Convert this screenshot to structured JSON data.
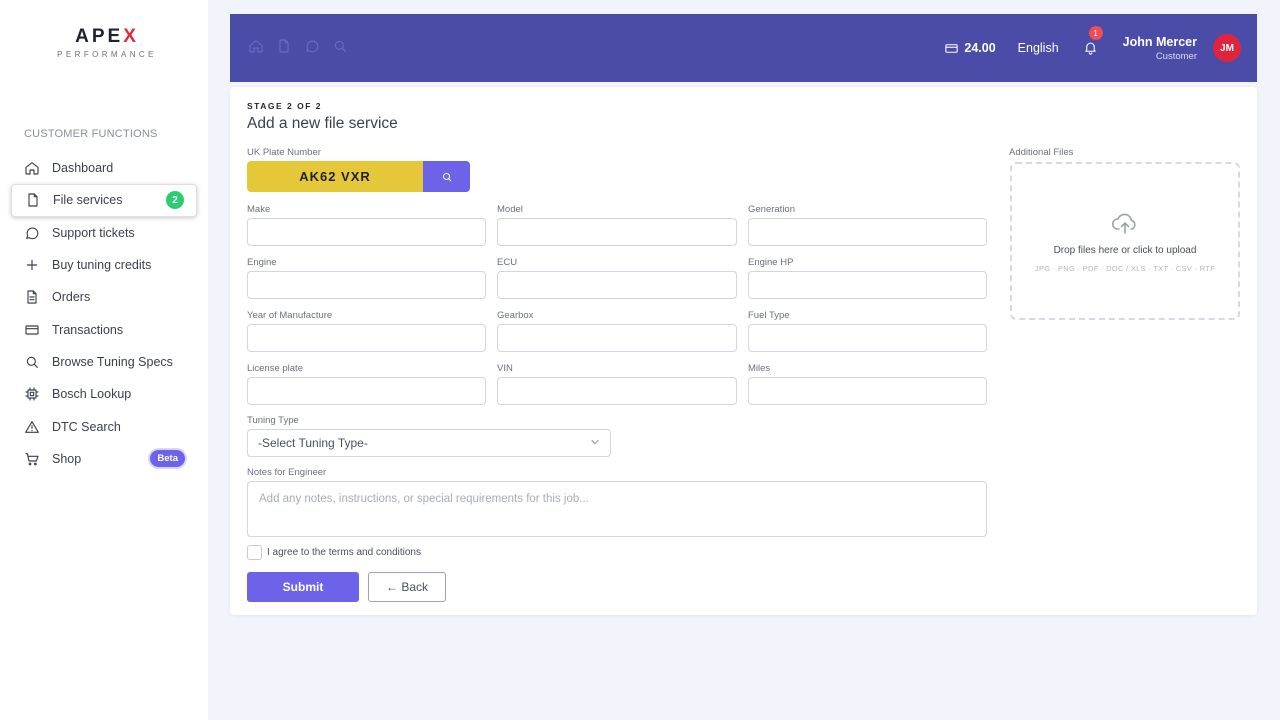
{
  "brand": {
    "name_prefix": "APE",
    "name_suffix": "X",
    "tagline": "PERFORMANCE"
  },
  "sidebar": {
    "section_title": "CUSTOMER FUNCTIONS",
    "items": [
      {
        "label": "Dashboard",
        "icon": "home-icon"
      },
      {
        "label": "File services",
        "icon": "file-icon",
        "badge": "2"
      },
      {
        "label": "Support tickets",
        "icon": "chat-icon"
      },
      {
        "label": "Buy tuning credits",
        "icon": "plus-icon"
      },
      {
        "label": "Orders",
        "icon": "document-icon"
      },
      {
        "label": "Transactions",
        "icon": "card-icon"
      },
      {
        "label": "Browse Tuning Specs",
        "icon": "search-icon"
      },
      {
        "label": "Bosch Lookup",
        "icon": "chip-icon"
      },
      {
        "label": "DTC Search",
        "icon": "warning-icon"
      },
      {
        "label": "Shop",
        "icon": "cart-icon",
        "badge": "Beta"
      }
    ]
  },
  "header": {
    "credits": "24.00",
    "language": "English",
    "notifications": "1",
    "user_name": "John Mercer",
    "user_role": "Customer",
    "avatar_initials": "JM"
  },
  "form": {
    "stage": "STAGE 2 OF 2",
    "title": "Add a new file service",
    "plate_label": "UK Plate Number",
    "plate_value": "AK62 VXR",
    "fields": {
      "make": "Make",
      "model": "Model",
      "generation": "Generation",
      "engine": "Engine",
      "ecu": "ECU",
      "engine_hp": "Engine HP",
      "year": "Year of Manufacture",
      "gearbox": "Gearbox",
      "fuel_type": "Fuel Type",
      "license_plate": "License plate",
      "vin": "VIN",
      "miles": "Miles"
    },
    "tuning_type_label": "Tuning Type",
    "tuning_type_value": "-Select Tuning Type-",
    "notes_label": "Notes for Engineer",
    "notes_placeholder": "Add any notes, instructions, or special requirements for this job...",
    "terms_label": "I agree to the terms and conditions",
    "submit_label": "Submit",
    "back_label": "← Back"
  },
  "upload": {
    "label": "Additional Files",
    "drop_text": "Drop files here or click to upload",
    "file_types": "JPG · PNG · PDF · DOC / XLS · TXT · CSV · RTF"
  },
  "colors": {
    "header_bg": "#4a4ca8",
    "accent": "#6c63e8",
    "plate_bg": "#e4c83a",
    "success": "#2ecc71",
    "danger": "#e0243d"
  }
}
